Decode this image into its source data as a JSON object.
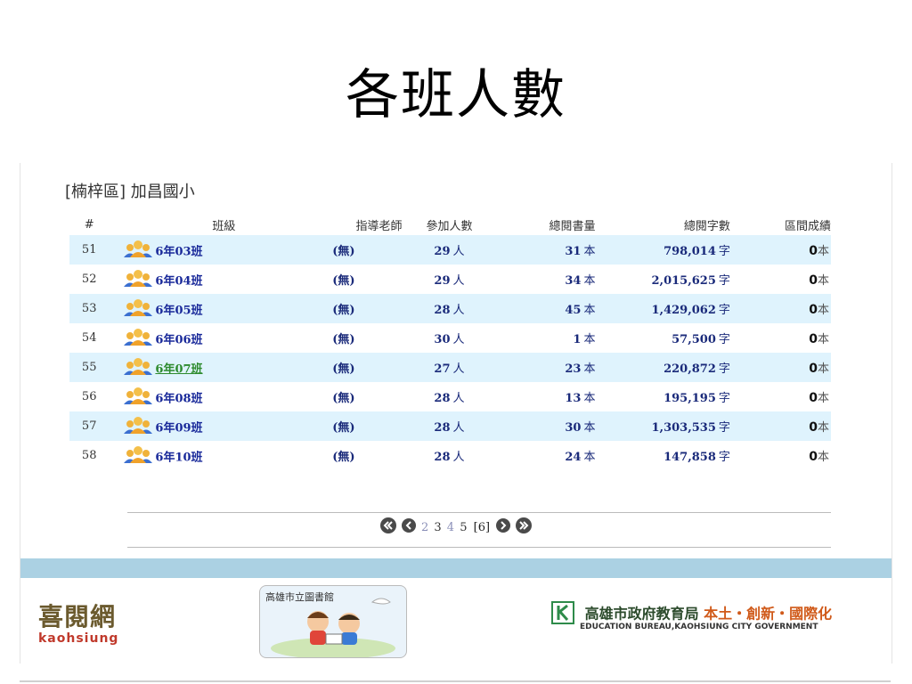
{
  "slide": {
    "title": "各班人數"
  },
  "school": {
    "heading": "[楠梓區] 加昌國小"
  },
  "table": {
    "headers": [
      "#",
      "班級",
      "指導老師",
      "參加人數",
      "總閱書量",
      "總閱字數",
      "區間成績"
    ],
    "rows": [
      {
        "num": "51",
        "name": "6年03班",
        "teacher": "(無)",
        "participants": "29",
        "books": "31",
        "words": "798,014",
        "score": "0"
      },
      {
        "num": "52",
        "name": "6年04班",
        "teacher": "(無)",
        "participants": "29",
        "books": "34",
        "words": "2,015,625",
        "score": "0"
      },
      {
        "num": "53",
        "name": "6年05班",
        "teacher": "(無)",
        "participants": "28",
        "books": "45",
        "words": "1,429,062",
        "score": "0"
      },
      {
        "num": "54",
        "name": "6年06班",
        "teacher": "(無)",
        "participants": "30",
        "books": "1",
        "words": "57,500",
        "score": "0"
      },
      {
        "num": "55",
        "name": "6年07班",
        "teacher": "(無)",
        "participants": "27",
        "books": "23",
        "words": "220,872",
        "score": "0"
      },
      {
        "num": "56",
        "name": "6年08班",
        "teacher": "(無)",
        "participants": "28",
        "books": "13",
        "words": "195,195",
        "score": "0"
      },
      {
        "num": "57",
        "name": "6年09班",
        "teacher": "(無)",
        "participants": "28",
        "books": "30",
        "words": "1,303,535",
        "score": "0"
      },
      {
        "num": "58",
        "name": "6年10班",
        "teacher": "(無)",
        "participants": "28",
        "books": "24",
        "words": "147,858",
        "score": "0"
      }
    ],
    "units": {
      "people": "人",
      "books": "本",
      "words": "字",
      "score": "本"
    }
  },
  "pager": {
    "pages": [
      "2",
      "3",
      "4",
      "5"
    ],
    "current": "[6]"
  },
  "footer": {
    "site_name": "喜閱網",
    "site_sub": "kaohsiung",
    "library_name": "高雄市立圖書館",
    "gov_name": "高雄市政府教育局",
    "gov_slogan": "本土・創新・國際化",
    "gov_english": "EDUCATION BUREAU,KAOHSIUNG CITY GOVERNMENT"
  },
  "colors": {
    "row_highlight": "#dff3fd",
    "band": "#abd1e3",
    "link": "#1a2a9a",
    "visited_link": "#2e8b2e"
  }
}
